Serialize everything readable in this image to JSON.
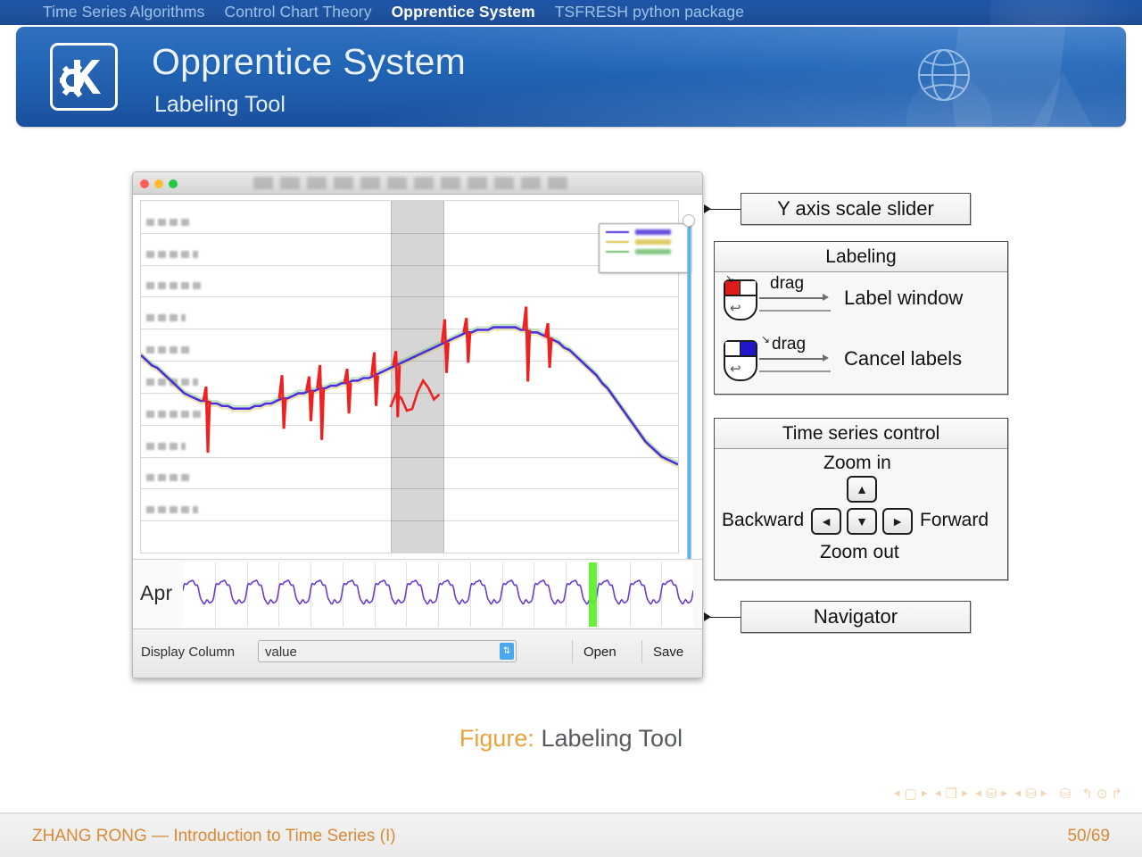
{
  "nav": {
    "items": [
      {
        "label": "Time Series Algorithms",
        "active": false
      },
      {
        "label": "Control Chart Theory",
        "active": false
      },
      {
        "label": "Opprentice System",
        "active": true
      },
      {
        "label": "TSFRESH python package",
        "active": false
      }
    ]
  },
  "header": {
    "title": "Opprentice System",
    "subtitle": "Labeling Tool",
    "logo_icon": "kde-k-gear-icon",
    "globe_icon": "globe-icon",
    "accent_color": "#1d59a8"
  },
  "screenshot": {
    "window": {
      "close_label": "close",
      "minimize_label": "minimize",
      "zoom_label": "zoom",
      "title": ""
    },
    "y_slider": {
      "name": "Y axis scale slider",
      "value_position": "top"
    },
    "legend": {
      "entries": [
        {
          "label": "",
          "color": "#4b2fd6"
        },
        {
          "label": "",
          "color": "#d8c14a"
        },
        {
          "label": "",
          "color": "#6fbf6f"
        }
      ]
    },
    "navigator": {
      "month_label": "Apr",
      "marker_color": "#5bf028"
    },
    "bottom_bar": {
      "display_column_label": "Display Column",
      "display_column_value": "value",
      "display_column_placeholder": "value",
      "open_label": "Open",
      "save_label": "Save",
      "stepper_icon": "stepper-updown-icon"
    }
  },
  "annotations": {
    "y_axis_slider": "Y axis scale slider",
    "navigator": "Navigator",
    "labeling": {
      "title": "Labeling",
      "rows": [
        {
          "button": "left",
          "button_color": "#e01b1b",
          "gesture": "drag",
          "action": "Label window"
        },
        {
          "button": "right",
          "button_color": "#2116c8",
          "gesture": "drag",
          "action": "Cancel labels"
        }
      ]
    },
    "time_series_control": {
      "title": "Time series control",
      "zoom_in": "Zoom in",
      "zoom_out": "Zoom out",
      "backward": "Backward",
      "forward": "Forward",
      "keys": {
        "up": "▲",
        "down": "▼",
        "left": "◄",
        "right": "►"
      }
    }
  },
  "caption": {
    "key": "Figure:",
    "value": "Labeling Tool"
  },
  "beamer_nav": {
    "groups": [
      {
        "left": "◄",
        "symbol": "▢",
        "right": "►"
      },
      {
        "left": "◄",
        "symbol": "❐",
        "right": "►"
      },
      {
        "left": "◄",
        "symbol": "⛁",
        "right": "►"
      },
      {
        "left": "◄",
        "symbol": "⛁",
        "right": "►"
      }
    ],
    "tail": [
      "⛁",
      "↰",
      "⊙",
      "↱"
    ]
  },
  "footer": {
    "left": "ZHANG RONG — Introduction to Time Series (I)",
    "right": "50/69",
    "color": "#d98a34"
  },
  "chart_data": {
    "type": "line",
    "title": "",
    "xlabel": "",
    "ylabel": "",
    "gridlines": 10,
    "selection_band": {
      "start_pct": 46.5,
      "end_pct": 56.5
    },
    "series": [
      {
        "name": "value",
        "color": "#4b2fd6",
        "values": [
          62,
          60,
          58,
          57,
          55,
          53,
          51,
          49,
          47,
          46,
          45,
          44,
          44,
          43,
          43,
          42,
          42,
          41,
          41,
          41,
          41,
          42,
          42,
          43,
          43,
          44,
          45,
          45,
          46,
          47,
          47,
          48,
          48,
          49,
          49,
          50,
          50,
          51,
          51,
          52,
          52,
          53,
          53,
          54,
          55,
          56,
          57,
          58,
          59,
          60,
          61,
          62,
          63,
          64,
          65,
          66,
          67,
          68,
          69,
          70,
          71,
          71,
          72,
          72,
          72,
          73,
          73,
          73,
          73,
          73,
          72,
          72,
          71,
          71,
          70,
          69,
          68,
          67,
          65,
          64,
          62,
          60,
          58,
          56,
          54,
          51,
          49,
          46,
          43,
          40,
          37,
          34,
          31,
          28,
          26,
          24,
          22,
          21,
          20,
          19
        ]
      },
      {
        "name": "pred min",
        "color": "#d8c14a",
        "values": [
          61,
          59,
          57,
          56,
          54,
          52,
          50,
          48,
          46,
          45,
          44,
          43,
          43,
          42,
          42,
          41,
          41,
          40,
          40,
          40,
          40,
          41,
          41,
          42,
          42,
          43,
          44,
          44,
          45,
          46,
          46,
          47,
          47,
          48,
          48,
          49,
          49,
          50,
          50,
          51,
          51,
          52,
          52,
          53,
          54,
          55,
          56,
          57,
          58,
          59,
          60,
          61,
          62,
          63,
          64,
          65,
          66,
          67,
          68,
          69,
          70,
          70,
          71,
          71,
          71,
          72,
          72,
          72,
          72,
          72,
          71,
          71,
          70,
          70,
          69,
          68,
          67,
          66,
          64,
          63,
          61,
          59,
          57,
          55,
          53,
          50,
          48,
          45,
          42,
          39,
          36,
          33,
          30,
          27,
          25,
          23,
          21,
          20,
          19,
          18
        ]
      },
      {
        "name": "pred max",
        "color": "#6fbf6f",
        "values": [
          63,
          61,
          59,
          58,
          56,
          54,
          52,
          50,
          48,
          47,
          46,
          45,
          45,
          44,
          44,
          43,
          43,
          42,
          42,
          42,
          42,
          43,
          43,
          44,
          44,
          45,
          46,
          46,
          47,
          48,
          48,
          49,
          49,
          50,
          50,
          51,
          51,
          52,
          52,
          53,
          53,
          54,
          54,
          55,
          56,
          57,
          58,
          59,
          60,
          61,
          62,
          63,
          64,
          65,
          66,
          67,
          68,
          69,
          70,
          71,
          72,
          72,
          73,
          73,
          73,
          74,
          74,
          74,
          74,
          74,
          73,
          73,
          72,
          72,
          71,
          70,
          69,
          68,
          66,
          65,
          63,
          61,
          59,
          57,
          55,
          52,
          50,
          47,
          44,
          41,
          38,
          35,
          32,
          29,
          27,
          25,
          23,
          22,
          21,
          20
        ]
      }
    ],
    "anomalies": {
      "color": "#ef2020",
      "spikes_pct": [
        12.5,
        26.5,
        31.5,
        33.5,
        38.0,
        43.5,
        47.5,
        57.0,
        61.0,
        72.0,
        75.5
      ],
      "depressed_region_pct": [
        46.0,
        56.0
      ]
    },
    "navigator_series": {
      "name": "overview",
      "color": "#6a3cd0",
      "period_count": 16,
      "month_label": "Apr"
    }
  }
}
